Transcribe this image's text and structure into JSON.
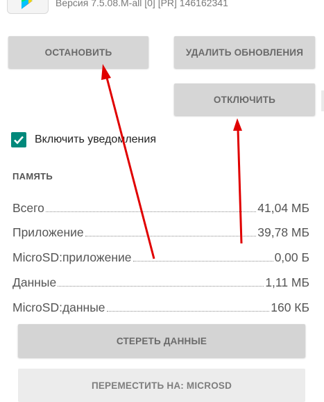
{
  "app": {
    "version": "Версия 7.5.08.M-all [0] [PR] 146162341",
    "icon": "play-store-icon"
  },
  "buttons": {
    "stop": "ОСТАНОВИТЬ",
    "uninstall_updates": "УДАЛИТЬ ОБНОВЛЕНИЯ",
    "disable": "ОТКЛЮЧИТЬ",
    "clear_data": "СТЕРЕТЬ ДАННЫЕ",
    "move_to_sd": "ПЕРЕМЕСТИТЬ НА: MICROSD"
  },
  "notifications": {
    "label": "Включить уведомления",
    "checked": true
  },
  "memory": {
    "title": "ПАМЯТЬ",
    "rows": [
      {
        "label": "Всего",
        "value": "41,04 МБ"
      },
      {
        "label": "Приложение",
        "value": "39,78 МБ"
      },
      {
        "label": "MicroSD:приложение",
        "value": "0,00 Б"
      },
      {
        "label": "Данные",
        "value": "1,11 МБ"
      },
      {
        "label": "MicroSD:данные",
        "value": "160 КБ"
      }
    ]
  },
  "colors": {
    "accent": "#00897b",
    "annotation_arrow": "#e00000",
    "button_bg": "#d6d6d6"
  }
}
